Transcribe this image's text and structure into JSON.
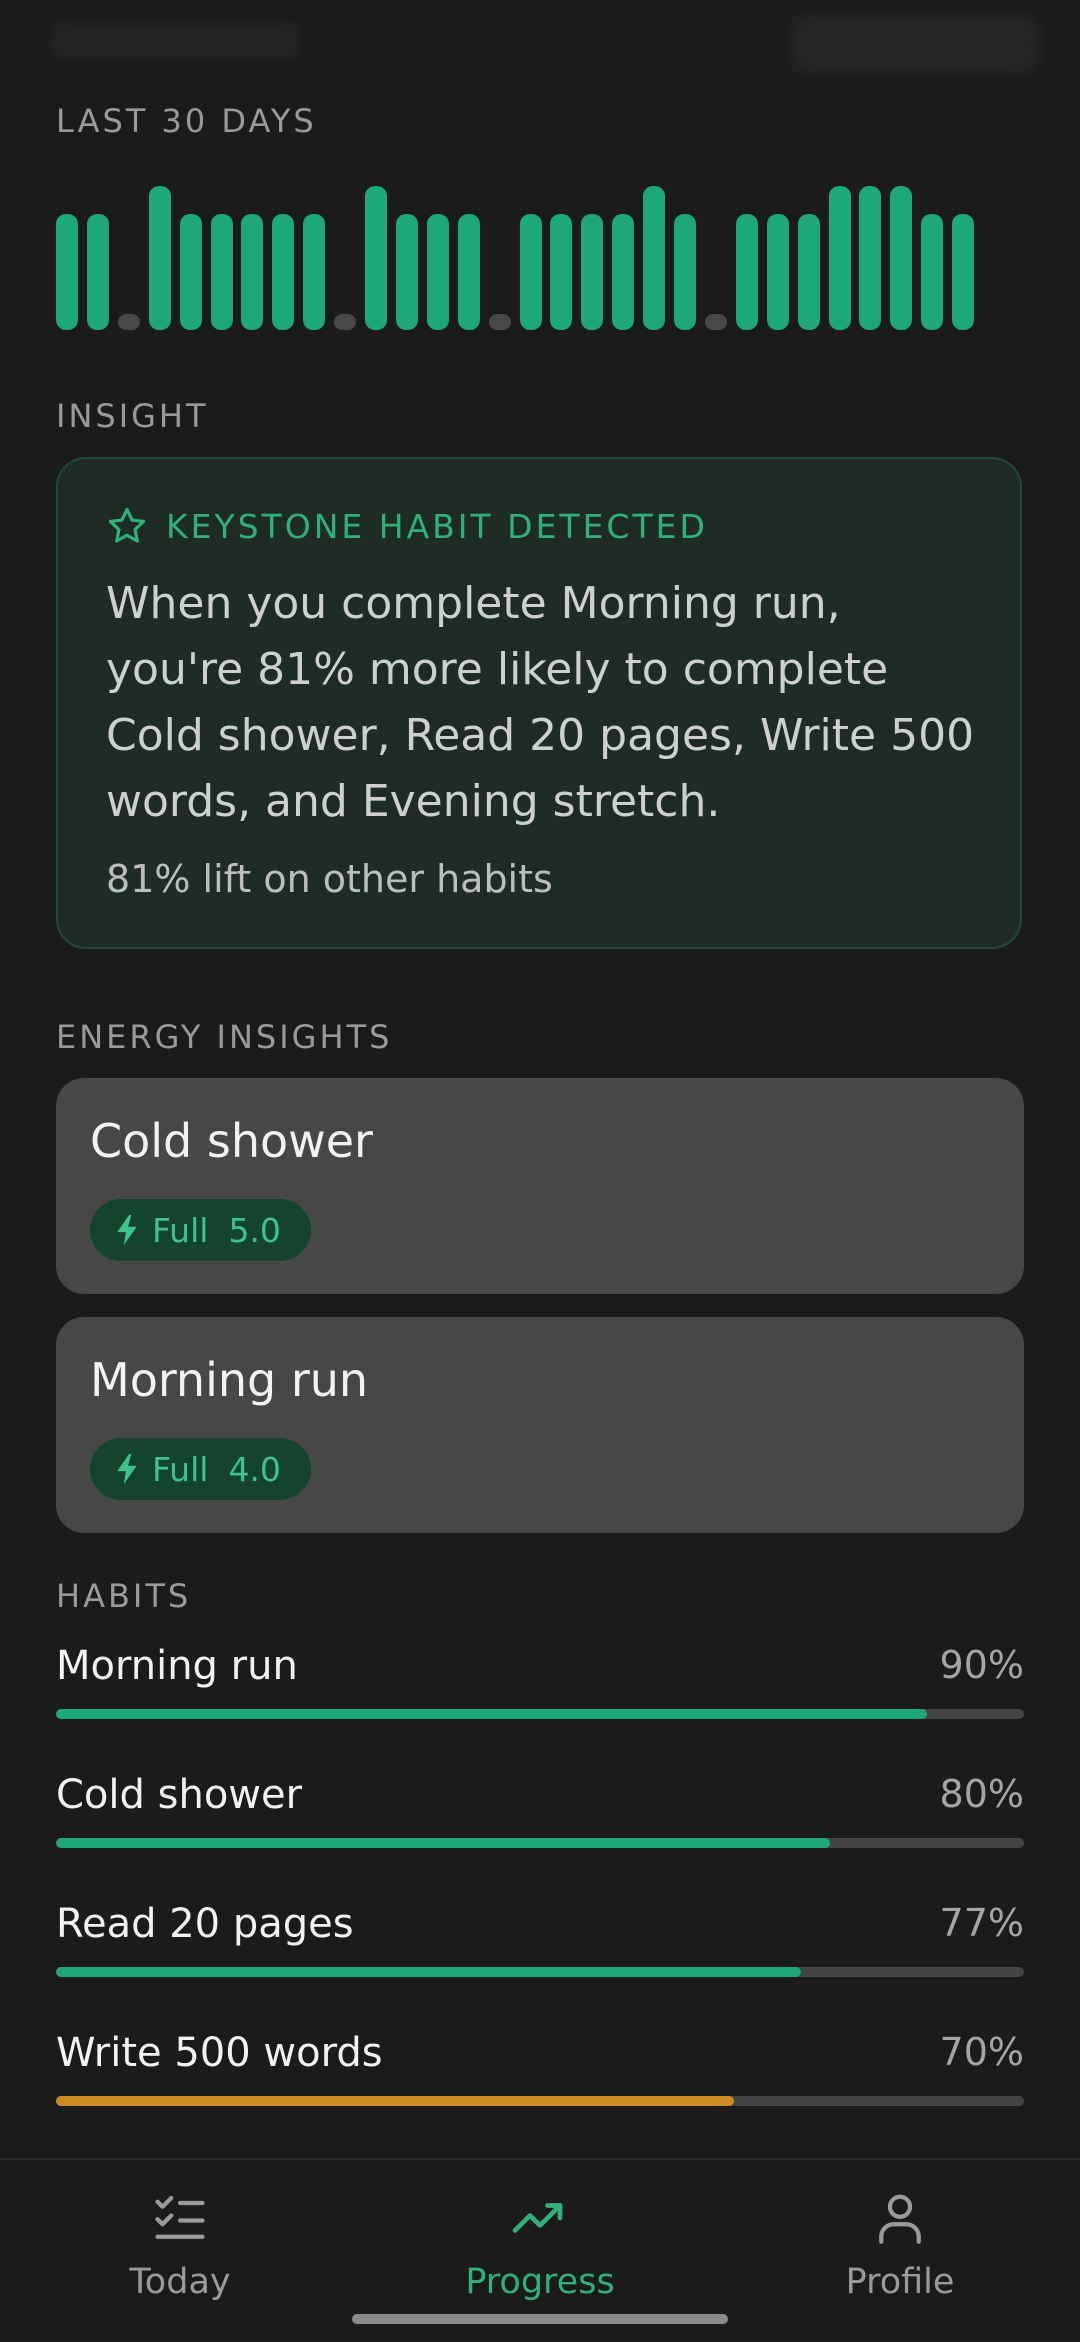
{
  "sections": {
    "last30": "LAST 30 DAYS",
    "insight": "INSIGHT",
    "energy": "ENERGY INSIGHTS",
    "habits": "HABITS"
  },
  "activity_days": [
    1,
    1,
    0,
    1,
    1,
    1,
    1,
    1,
    1,
    0,
    1,
    1,
    1,
    1,
    0,
    1,
    1,
    1,
    1,
    1,
    1,
    0,
    1,
    1,
    1,
    1,
    1,
    1,
    1,
    1
  ],
  "colors": {
    "accent": "#2fb277",
    "bar": "#1fa877",
    "bar_empty": "#484848",
    "warning": "#d08a24",
    "track": "#444444"
  },
  "insight_card": {
    "icon": "star-icon",
    "heading": "KEYSTONE HABIT DETECTED",
    "body": "When you complete Morning run, you're 81% more likely to complete Cold shower, Read 20 pages, Write 500 words, and Evening stretch.",
    "footer": "81% lift on other habits"
  },
  "energy_cards": [
    {
      "title": "Cold shower",
      "badge_label": "Full",
      "badge_value": "5.0",
      "icon": "bolt-icon"
    },
    {
      "title": "Morning run",
      "badge_label": "Full",
      "badge_value": "4.0",
      "icon": "bolt-icon"
    }
  ],
  "habits": [
    {
      "name": "Morning run",
      "percent_label": "90%",
      "progress": 0.9,
      "color": "#1fa877"
    },
    {
      "name": "Cold shower",
      "percent_label": "80%",
      "progress": 0.8,
      "color": "#1fa877"
    },
    {
      "name": "Read 20 pages",
      "percent_label": "77%",
      "progress": 0.77,
      "color": "#1fa877"
    },
    {
      "name": "Write 500 words",
      "percent_label": "70%",
      "progress": 0.7,
      "color": "#d08a24"
    }
  ],
  "nav": [
    {
      "label": "Today",
      "icon": "checklist-icon",
      "active": false
    },
    {
      "label": "Progress",
      "icon": "trending-up-icon",
      "active": true
    },
    {
      "label": "Profile",
      "icon": "person-icon",
      "active": false
    }
  ]
}
